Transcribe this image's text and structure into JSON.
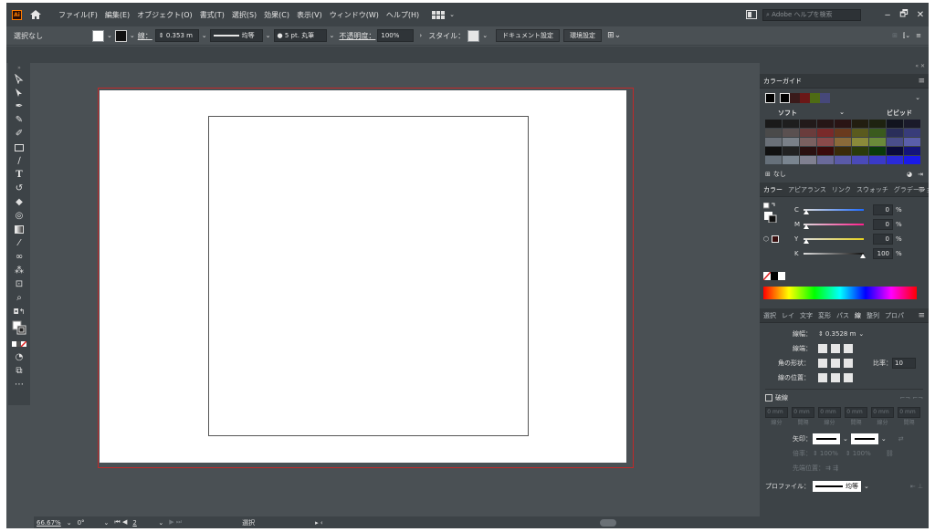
{
  "menu": {
    "logo": "Ai",
    "items": [
      "ファイル(F)",
      "編集(E)",
      "オブジェクト(O)",
      "書式(T)",
      "選択(S)",
      "効果(C)",
      "表示(V)",
      "ウィンドウ(W)",
      "ヘルプ(H)"
    ],
    "search_placeholder": "Adobe ヘルプを検索",
    "window_buttons": [
      "‒",
      "🗗",
      "✕"
    ]
  },
  "control": {
    "selection": "選択なし",
    "stroke_label": "線：",
    "stroke_value": "0.353 m",
    "stroke_profile": "均等",
    "brush": "5 pt. 丸筆",
    "opacity_label": "不透明度：",
    "opacity_value": "100%",
    "style_label": "スタイル：",
    "doc_setup": "ドキュメント設定",
    "prefs": "環境設定"
  },
  "status": {
    "zoom": "66.67%",
    "rotation": "0°",
    "artboard": "2",
    "tool": "選択"
  },
  "panel_color_guide": {
    "tab": "カラーガイド",
    "left_label": "ソフト",
    "right_label": "ビビッド",
    "none_label": "なし",
    "harmony_colors": [
      "#000000",
      "#3a1a1a",
      "#6b1717",
      "#4e6b14",
      "#46487a"
    ],
    "grid_colors": [
      [
        "#1a1a1a",
        "#1e1e1e",
        "#221a1a",
        "#261616",
        "#2a1414",
        "#221e10",
        "#1e2210",
        "#12141e",
        "#1a1a2a"
      ],
      [
        "#4a4a4a",
        "#5a5050",
        "#6a3c3c",
        "#7a2a2a",
        "#6a3a1e",
        "#5a5a1e",
        "#3a5a1e",
        "#2a2e5a",
        "#383c7a"
      ],
      [
        "#6a7078",
        "#7a8088",
        "#7a6060",
        "#8a4a4a",
        "#8a6a3a",
        "#8a8a3a",
        "#6a8a3a",
        "#4a4e8a",
        "#5a5eaa"
      ],
      [
        "#111111",
        "#222222",
        "#2a1010",
        "#3a0a0a",
        "#3a2a0a",
        "#2a3a0a",
        "#0a3a0a",
        "#0a0a3a",
        "#14147a"
      ],
      [
        "#66707a",
        "#7a8590",
        "#808090",
        "#6a6a9a",
        "#5a5aa8",
        "#4a4ab8",
        "#3a3ac8",
        "#2a2ad8",
        "#1a1ae8"
      ]
    ]
  },
  "panel_color": {
    "tabs": [
      "カラー",
      "アピアランス",
      "リンク",
      "スウォッチ",
      "グラデーション"
    ],
    "channels": [
      {
        "name": "C",
        "value": "0",
        "unit": "%"
      },
      {
        "name": "M",
        "value": "0",
        "unit": "%"
      },
      {
        "name": "Y",
        "value": "0",
        "unit": "%"
      },
      {
        "name": "K",
        "value": "100",
        "unit": "%"
      }
    ]
  },
  "panel_stroke": {
    "tabs": [
      "選択",
      "レイ",
      "文字",
      "変形",
      "パス",
      "線",
      "整列",
      "プロパ"
    ],
    "weight_label": "線幅：",
    "weight_value": "0.3528 m",
    "cap_label": "線端：",
    "corner_label": "角の形状：",
    "limit_label": "比率：",
    "limit_value": "10",
    "align_label": "線の位置：",
    "dashed_label": "破線",
    "dash_fields": [
      "0 mm",
      "0 mm",
      "0 mm",
      "0 mm",
      "0 mm",
      "0 mm"
    ],
    "dash_labels": [
      "線分",
      "間隔",
      "線分",
      "間隔",
      "線分",
      "間隔"
    ],
    "arrow_label": "矢印：",
    "scale_label": "倍率：",
    "scale_values": [
      "100%",
      "100%"
    ],
    "tip_label": "先端位置：",
    "profile_label": "プロファイル：",
    "profile_value": "均等"
  }
}
